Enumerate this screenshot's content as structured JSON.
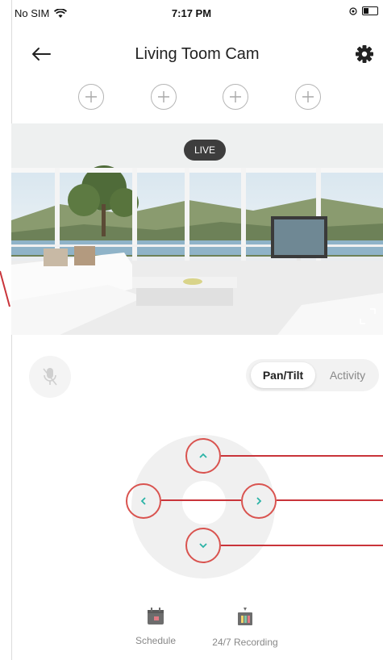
{
  "status_bar": {
    "carrier": "No SIM",
    "time": "7:17 PM"
  },
  "header": {
    "title": "Living Toom Cam"
  },
  "video": {
    "live_label": "LIVE"
  },
  "mode_toggle": {
    "active_label": "Pan/Tilt",
    "inactive_label": "Activity"
  },
  "bottom_bar": {
    "schedule_label": "Schedule",
    "recording_label": "24/7 Recording"
  },
  "colors": {
    "callout": "#c9343a",
    "live_badge_bg": "#3d3d3d"
  }
}
